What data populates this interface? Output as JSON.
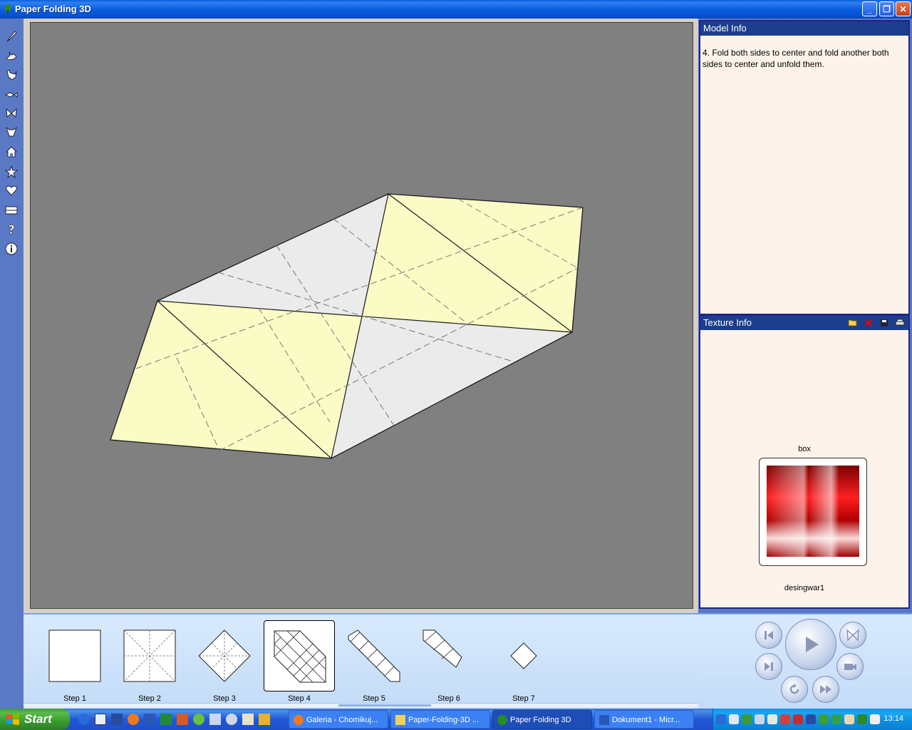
{
  "window": {
    "title": "Paper Folding 3D",
    "controls": {
      "minimize": "_",
      "maximize": "❐",
      "close": "✕"
    }
  },
  "toolbar": {
    "icons": [
      "brush-icon",
      "rabbit-icon",
      "rooster-icon",
      "fish-icon",
      "butterfly-icon",
      "bull-icon",
      "house-icon",
      "star-icon",
      "heart-icon",
      "box-icon",
      "help-icon",
      "info-icon"
    ]
  },
  "model_info": {
    "header": "Model Info",
    "text": "4. Fold both sides to center and fold another both sides to center and unfold them."
  },
  "texture_info": {
    "header": "Texture Info",
    "texture_name": "box",
    "thumbnail_caption": "desingwar1",
    "tools": [
      "open-folder-icon",
      "delete-icon",
      "save-icon",
      "print-icon"
    ]
  },
  "steps": [
    {
      "label": "Step 1"
    },
    {
      "label": "Step 2"
    },
    {
      "label": "Step 3"
    },
    {
      "label": "Step 4",
      "selected": true
    },
    {
      "label": "Step 5"
    },
    {
      "label": "Step 6"
    },
    {
      "label": "Step 7"
    }
  ],
  "playback": {
    "buttons": [
      "first-step",
      "play",
      "preview",
      "next-step",
      "camera",
      "repeat",
      "fast-forward"
    ]
  },
  "taskbar": {
    "start": "Start",
    "tasks": [
      {
        "label": "Galeria - Chomikuj...",
        "active": false
      },
      {
        "label": "Paper-Folding-3D ...",
        "active": false
      },
      {
        "label": "Paper Folding 3D",
        "active": true
      },
      {
        "label": "Dokument1 - Micr...",
        "active": false
      }
    ],
    "clock": "13:14"
  },
  "colors": {
    "paper_front": "#fbfbc6",
    "paper_back": "#ebebeb",
    "viewport_bg": "#808080",
    "header_bg": "#1c3e8e"
  }
}
